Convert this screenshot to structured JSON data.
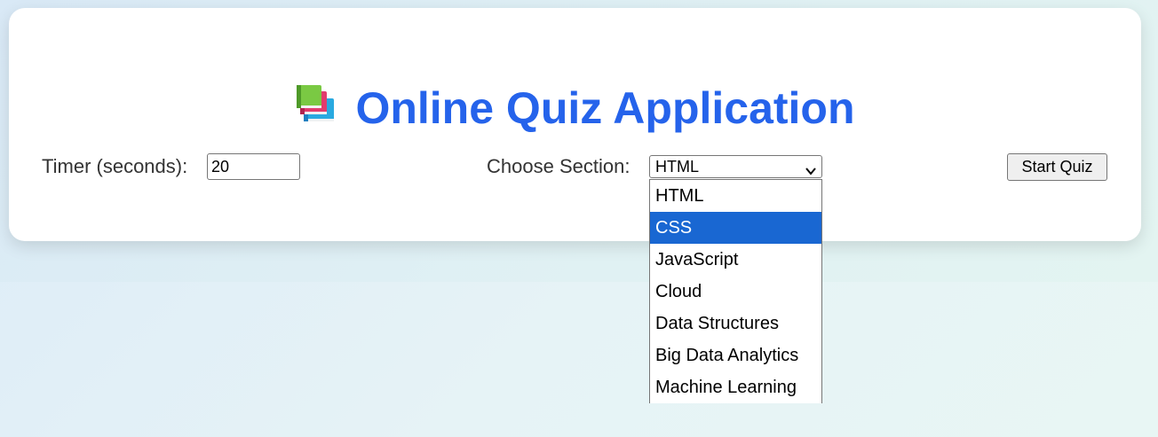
{
  "page": {
    "title": "Online Quiz Application",
    "title_icon": "books-icon"
  },
  "controls": {
    "timer_label": "Timer (seconds):",
    "timer_value": "20",
    "section_label": "Choose Section:",
    "section_selected": "HTML",
    "start_button": "Start Quiz"
  },
  "dropdown": {
    "highlighted": "CSS",
    "options": [
      "HTML",
      "CSS",
      "JavaScript",
      "Cloud",
      "Data Structures",
      "Big Data Analytics",
      "Machine Learning"
    ]
  },
  "colors": {
    "title": "#2563eb",
    "highlight": "#1967d2"
  }
}
